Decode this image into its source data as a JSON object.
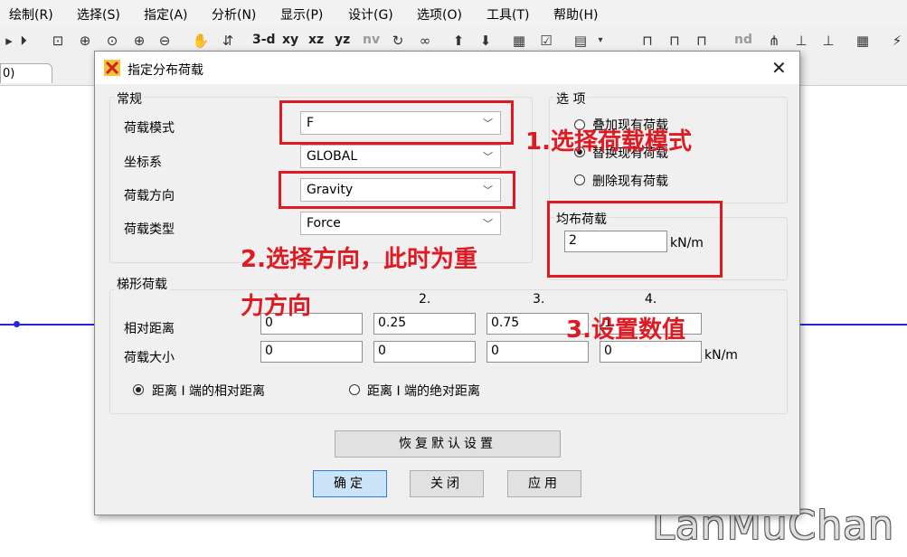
{
  "menu": [
    "绘制(R)",
    "选择(S)",
    "指定(A)",
    "分析(N)",
    "显示(P)",
    "设计(G)",
    "选项(O)",
    "工具(T)",
    "帮助(H)"
  ],
  "toolbar": {
    "view_3d": "3-d",
    "view_xy": "xy",
    "view_xz": "xz",
    "view_yz": "yz",
    "view_nv": "nv",
    "nd": "nd"
  },
  "tab": {
    "label": "0)"
  },
  "dialog": {
    "title": "指定分布荷载",
    "general": {
      "group_label": "常规",
      "load_pattern_label": "荷载模式",
      "load_pattern_value": "F",
      "coord_system_label": "坐标系",
      "coord_system_value": "GLOBAL",
      "load_direction_label": "荷载方向",
      "load_direction_value": "Gravity",
      "load_type_label": "荷载类型",
      "load_type_value": "Force"
    },
    "options": {
      "group_label": "选 项",
      "add": "叠加现有荷载",
      "replace": "替换现有荷载",
      "delete": "删除现有荷载",
      "selected": "replace"
    },
    "uniform": {
      "group_label": "均布荷载",
      "value": "2",
      "unit": "kN/m"
    },
    "trapezoid": {
      "group_label": "梯形荷载",
      "col_headers": [
        "2.",
        "3.",
        "4."
      ],
      "distance_label": "相对距离",
      "distances": [
        "0",
        "0.25",
        "0.75",
        "1"
      ],
      "magnitude_label": "荷载大小",
      "magnitudes": [
        "0",
        "0",
        "0",
        "0"
      ],
      "unit": "kN/m",
      "relative_option": "距离 I 端的相对距离",
      "absolute_option": "距离 I 端的绝对距离",
      "selected": "relative"
    },
    "buttons": {
      "reset": "恢复默认设置",
      "ok": "确定",
      "close": "关闭",
      "apply": "应用"
    }
  },
  "annotations": {
    "step1": "1.选择荷载模式",
    "step2_line1": "2.选择方向，此时为重",
    "step2_line2": "力方向",
    "step3": "3.设置数值"
  },
  "watermark": "LanMuChan",
  "colors": {
    "annotation": "#e01a22",
    "beam": "#2626d6",
    "default_button": "#cce4f7"
  }
}
